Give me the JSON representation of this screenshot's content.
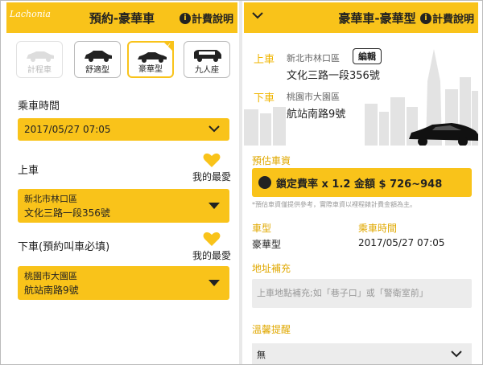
{
  "left": {
    "watermark": "Lachonia",
    "header_title": "預約-豪華車",
    "help_label": "計費說明",
    "car_types": [
      {
        "label": "計程車",
        "state": "disabled"
      },
      {
        "label": "舒適型",
        "state": "normal"
      },
      {
        "label": "豪華型",
        "state": "selected"
      },
      {
        "label": "九人座",
        "state": "normal"
      }
    ],
    "ride_time_label": "乘車時間",
    "ride_time_value": "2017/05/27 07:05",
    "pickup_label": "上車",
    "pickup_fav_label": "我的最愛",
    "pickup_district": "新北市林口區",
    "pickup_address": "文化三路一段356號",
    "dropoff_label": "下車(預約叫車必填)",
    "dropoff_fav_label": "我的最愛",
    "dropoff_district": "桃園市大園區",
    "dropoff_address": "航站南路9號"
  },
  "right": {
    "header_title": "豪華車-豪華型",
    "help_label": "計費說明",
    "pickup_tag": "上車",
    "pickup_district": "新北市林口區",
    "edit_label": "編輯",
    "pickup_address": "文化三路一段356號",
    "dropoff_tag": "下車",
    "dropoff_district": "桃園市大園區",
    "dropoff_address": "航站南路9號",
    "fare_section_label": "預估車資",
    "fare_text": "鎖定費率 x 1.2  金額 $ 726~948",
    "fare_note": "*預估車資僅提供參考，實際車資以裡程錶計費金額為主。",
    "car_type_key": "車型",
    "car_type_value": "豪華型",
    "ride_time_key": "乘車時間",
    "ride_time_value": "2017/05/27 07:05",
    "address_note_label": "地址補充",
    "address_note_placeholder": "上車地點補充;如「巷子口」或「警衛室前」",
    "reminder_label": "溫馨提醒",
    "reminder_value": "無"
  },
  "colors": {
    "accent": "#f9c31a",
    "section_text": "#e0a800"
  },
  "icons": [
    "chevron-down-icon",
    "info-icon",
    "heart-icon",
    "sedan-icon",
    "van-icon",
    "caret-down-icon",
    "coin-icon"
  ]
}
